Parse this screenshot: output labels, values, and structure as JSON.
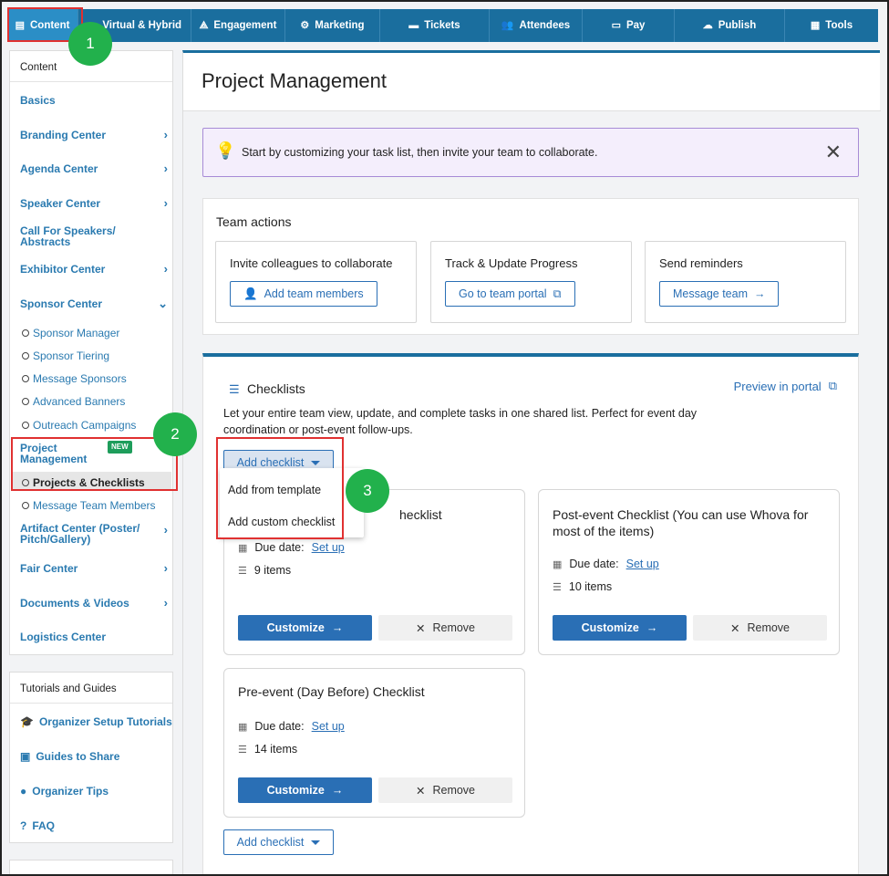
{
  "nav": [
    {
      "label": "Content",
      "icon": "list-icon",
      "glyph": "▤"
    },
    {
      "label": "Virtual & Hybrid",
      "icon": "monitor-icon",
      "glyph": "▭"
    },
    {
      "label": "Engagement",
      "icon": "network-icon",
      "glyph": "⟁"
    },
    {
      "label": "Marketing",
      "icon": "megaphone-icon",
      "glyph": "⚙"
    },
    {
      "label": "Tickets",
      "icon": "ticket-icon",
      "glyph": "▬"
    },
    {
      "label": "Attendees",
      "icon": "users-icon",
      "glyph": "👥"
    },
    {
      "label": "Pay",
      "icon": "credit-card-icon",
      "glyph": "▭"
    },
    {
      "label": "Publish",
      "icon": "cloud-upload-icon",
      "glyph": "☁"
    },
    {
      "label": "Tools",
      "icon": "toolbox-icon",
      "glyph": "▦"
    }
  ],
  "sidebar": {
    "header": "Content",
    "items": [
      "Basics",
      "Branding Center",
      "Agenda Center",
      "Speaker Center",
      "Call For Speakers/ Abstracts",
      "Exhibitor Center",
      "Sponsor Center"
    ],
    "sponsor_subs": [
      "Sponsor Manager",
      "Sponsor Tiering",
      "Message Sponsors",
      "Advanced Banners",
      "Outreach Campaigns"
    ],
    "pm_title": "Project Management",
    "new_badge": "NEW",
    "pm_subs": [
      "Projects & Checklists",
      "Message Team Members"
    ],
    "items2": [
      "Artifact Center (Poster/ Pitch/Gallery)",
      "Fair Center",
      "Documents & Videos",
      "Logistics Center"
    ]
  },
  "sidebar2": {
    "header": "Tutorials and Guides",
    "items": [
      "Organizer Setup Tutorials",
      "Guides to Share",
      "Organizer Tips",
      "FAQ"
    ]
  },
  "main": {
    "title": "Project Management",
    "banner": "Start by customizing your task list, then invite your team to collaborate.",
    "team_title": "Team actions",
    "team_boxes": [
      {
        "title": "Invite colleagues to collaborate",
        "button": "Add team members"
      },
      {
        "title": "Track & Update Progress",
        "button": "Go to team portal"
      },
      {
        "title": "Send reminders",
        "button": "Message team"
      }
    ],
    "checklists_title": "Checklists",
    "preview": "Preview in portal",
    "description": "Let your entire team view, update, and complete tasks in one shared list. Perfect for event day coordination or post-event follow-ups.",
    "add_checklist": "Add checklist",
    "dropdown": [
      "Add from template",
      "Add custom checklist"
    ],
    "cards": [
      {
        "name": "hecklist",
        "due_label": "Due date:",
        "due_link": "Set up",
        "items": "9 items"
      },
      {
        "name": "Post-event Checklist (You can use Whova for most of the items)",
        "due_label": "Due date:",
        "due_link": "Set up",
        "items": "10 items"
      },
      {
        "name": "Pre-event (Day Before) Checklist",
        "due_label": "Due date:",
        "due_link": "Set up",
        "items": "14 items"
      }
    ],
    "customize": "Customize",
    "remove": "Remove"
  },
  "annotations": [
    "1",
    "2",
    "3"
  ]
}
